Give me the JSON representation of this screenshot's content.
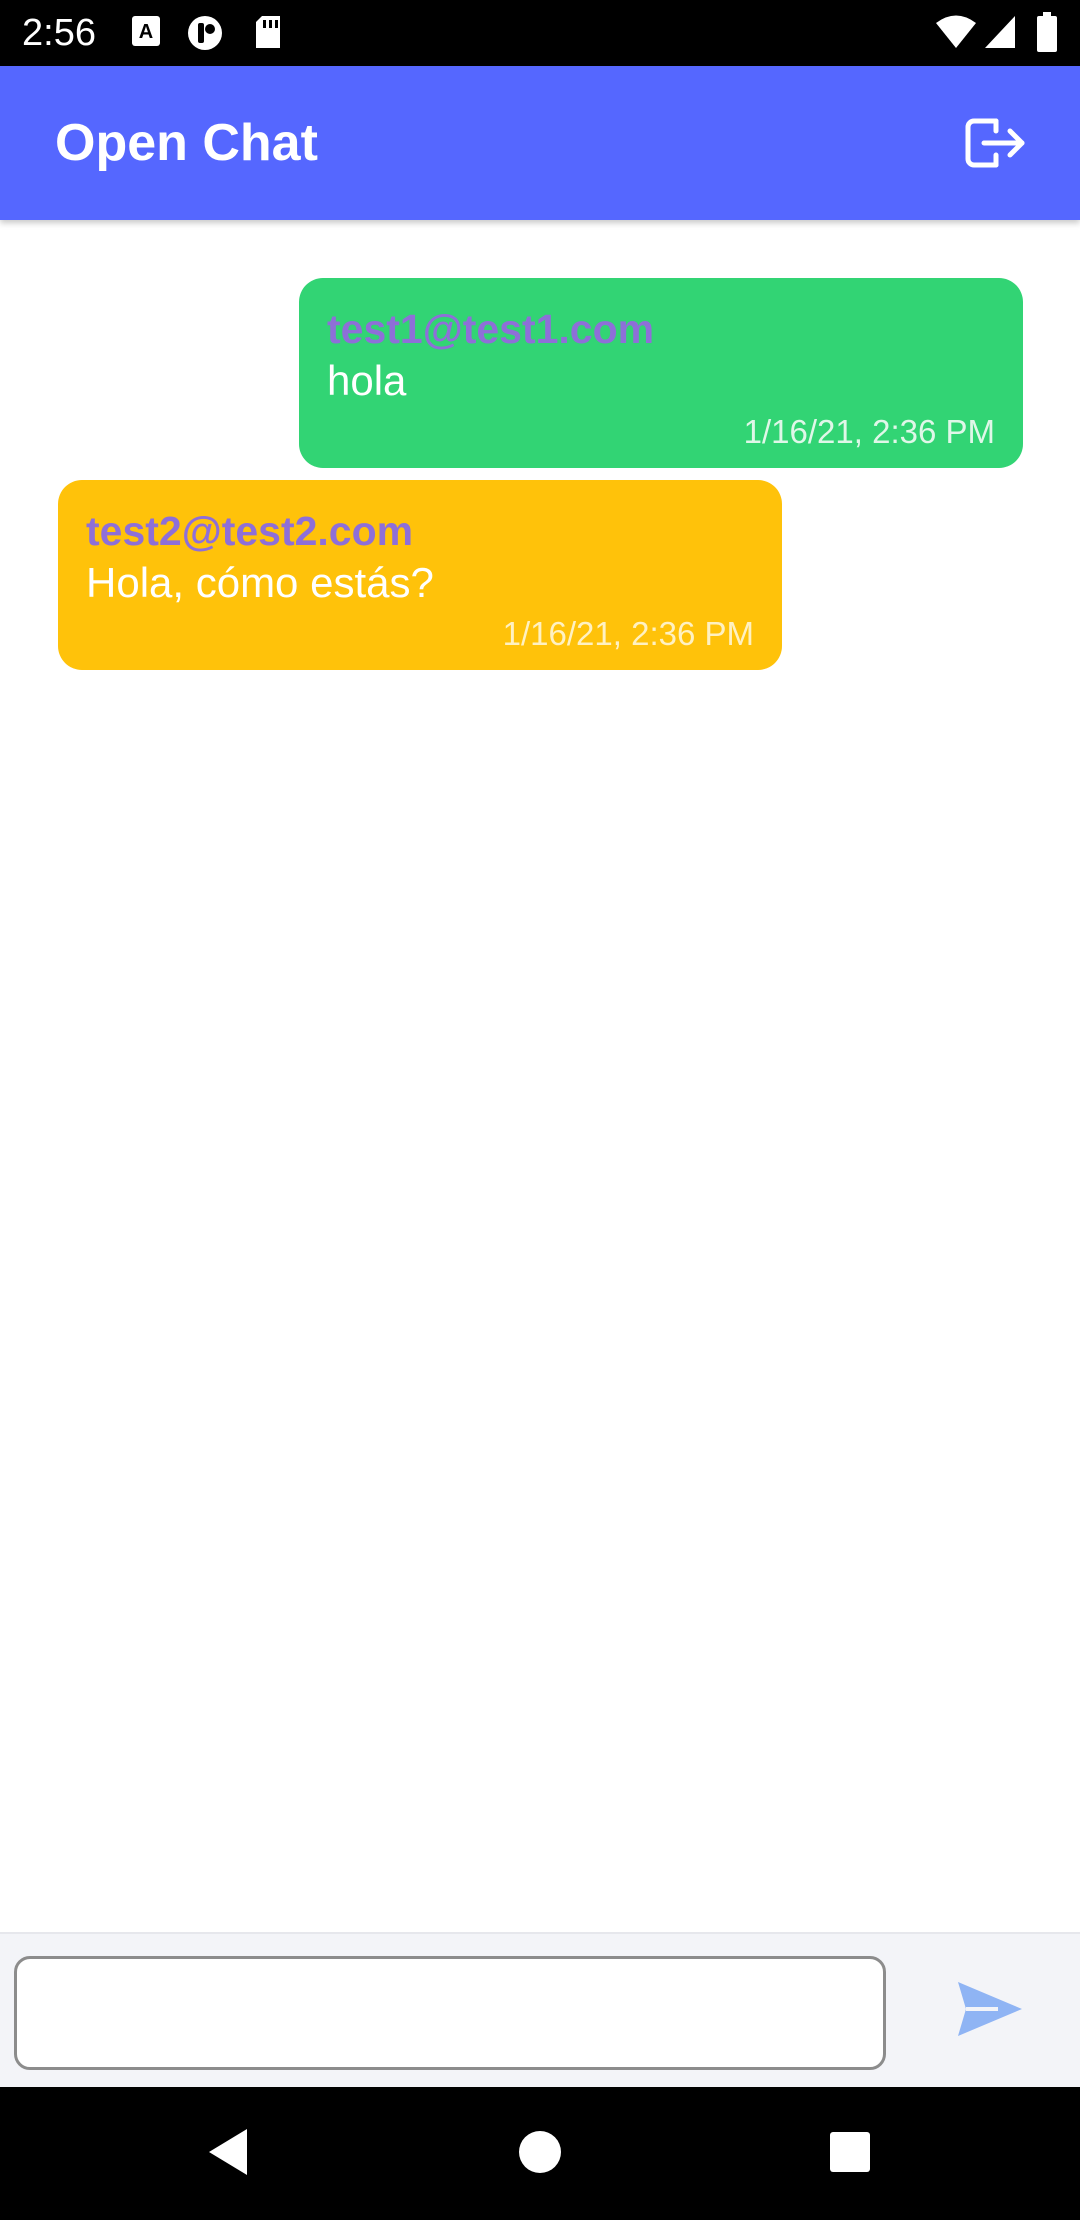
{
  "status_bar": {
    "time": "2:56",
    "icons": [
      "a11y-icon",
      "record-icon",
      "sd-card-icon",
      "wifi-icon",
      "signal-icon",
      "battery-icon"
    ]
  },
  "app_bar": {
    "title": "Open Chat",
    "logout_icon": "logout-icon",
    "color": "#5567ff"
  },
  "messages": [
    {
      "sender": "test1@test1.com",
      "text": "hola",
      "time": "1/16/21, 2:36 PM",
      "side": "right",
      "bubble_color": "#32d474",
      "time_color": "#dff7e8"
    },
    {
      "sender": "test2@test2.com",
      "text": "Hola, cómo estás?",
      "time": "1/16/21, 2:36 PM",
      "side": "left",
      "bubble_color": "#ffc20a",
      "time_color": "#fff1c2"
    }
  ],
  "composer": {
    "value": "",
    "send_icon": "send-icon",
    "send_color": "#8fb4f4"
  },
  "nav_bar": {
    "back_icon": "back-icon",
    "home_icon": "home-icon",
    "recents_icon": "recents-icon"
  }
}
